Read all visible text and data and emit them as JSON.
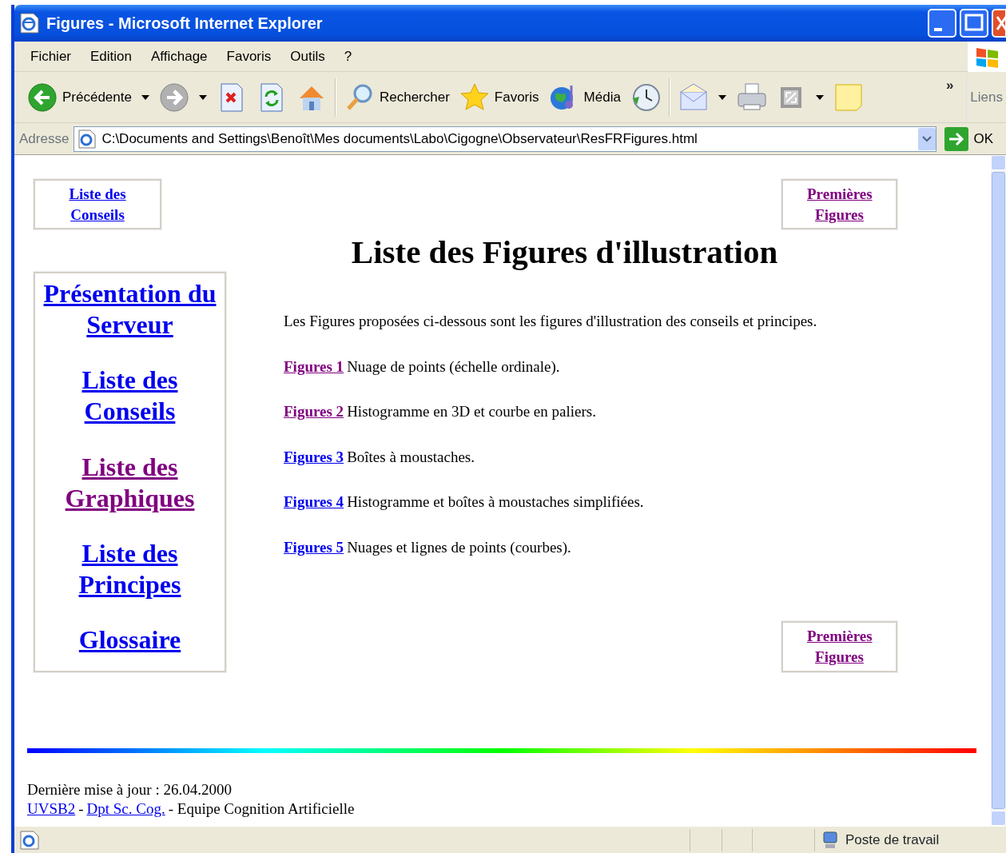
{
  "window": {
    "title": "Figures - Microsoft Internet Explorer"
  },
  "menu": [
    "Fichier",
    "Edition",
    "Affichage",
    "Favoris",
    "Outils",
    "?"
  ],
  "toolbar": [
    {
      "kind": "back",
      "label": "Précédente",
      "dropdown": true,
      "disabled": false
    },
    {
      "kind": "forward",
      "dropdown": true,
      "disabled": true
    },
    {
      "kind": "stop",
      "dropdown": false,
      "disabled": false
    },
    {
      "kind": "refresh",
      "dropdown": false,
      "disabled": false
    },
    {
      "kind": "home",
      "dropdown": false,
      "disabled": false
    },
    {
      "kind": "separator"
    },
    {
      "kind": "search",
      "label": "Rechercher",
      "dropdown": false,
      "disabled": false
    },
    {
      "kind": "favorites",
      "label": "Favoris",
      "dropdown": false,
      "disabled": false
    },
    {
      "kind": "media",
      "label": "Média",
      "dropdown": false,
      "disabled": false
    },
    {
      "kind": "history",
      "dropdown": false,
      "disabled": false
    },
    {
      "kind": "separator"
    },
    {
      "kind": "mail",
      "dropdown": true,
      "disabled": false
    },
    {
      "kind": "print",
      "dropdown": false,
      "disabled": false
    },
    {
      "kind": "edit",
      "dropdown": true,
      "disabled": false
    },
    {
      "kind": "note",
      "dropdown": false,
      "disabled": false
    }
  ],
  "toolbar_more": "»",
  "links_bar": "Liens",
  "address": {
    "label": "Adresse",
    "value": "C:\\Documents and Settings\\Benoît\\Mes documents\\Labo\\Cigogne\\Observateur\\ResFRFigures.html",
    "go": "OK"
  },
  "page": {
    "top_left_link": {
      "text": "Liste des Conseils",
      "visited": false
    },
    "top_right_link": {
      "text": "Premières Figures",
      "visited": true
    },
    "title": "Liste des Figures d'illustration",
    "nav": [
      {
        "text": "Présentation du Serveur",
        "visited": false
      },
      {
        "text": "Liste des Conseils",
        "visited": false
      },
      {
        "text": "Liste des Graphiques",
        "visited": true
      },
      {
        "text": "Liste des Principes",
        "visited": false
      },
      {
        "text": "Glossaire",
        "visited": false
      }
    ],
    "intro": "Les Figures proposées ci-dessous sont les figures d'illustration des conseils et principes.",
    "figures": [
      {
        "link": "Figures 1",
        "visited": true,
        "description": "Nuage de points (échelle ordinale)."
      },
      {
        "link": "Figures 2",
        "visited": true,
        "description": "Histogramme en 3D et courbe en paliers."
      },
      {
        "link": "Figures 3",
        "visited": false,
        "description": "Boîtes à moustaches."
      },
      {
        "link": "Figures 4",
        "visited": false,
        "description": "Histogramme et boîtes à moustaches simplifiées."
      },
      {
        "link": "Figures 5",
        "visited": false,
        "description": "Nuages et lignes de points (courbes)."
      }
    ],
    "bottom_right_link": {
      "text": "Premières Figures",
      "visited": true
    },
    "footer": {
      "updated": "Dernière mise à jour : 26.04.2000",
      "credits": [
        {
          "kind": "link",
          "text": "UVSB2"
        },
        {
          "kind": "text",
          "text": "-"
        },
        {
          "kind": "link",
          "text": "Dpt Sc. Cog."
        },
        {
          "kind": "text",
          "text": "- Equipe Cognition Artificielle"
        }
      ]
    }
  },
  "status_bar": {
    "zone": "Poste de travail"
  }
}
